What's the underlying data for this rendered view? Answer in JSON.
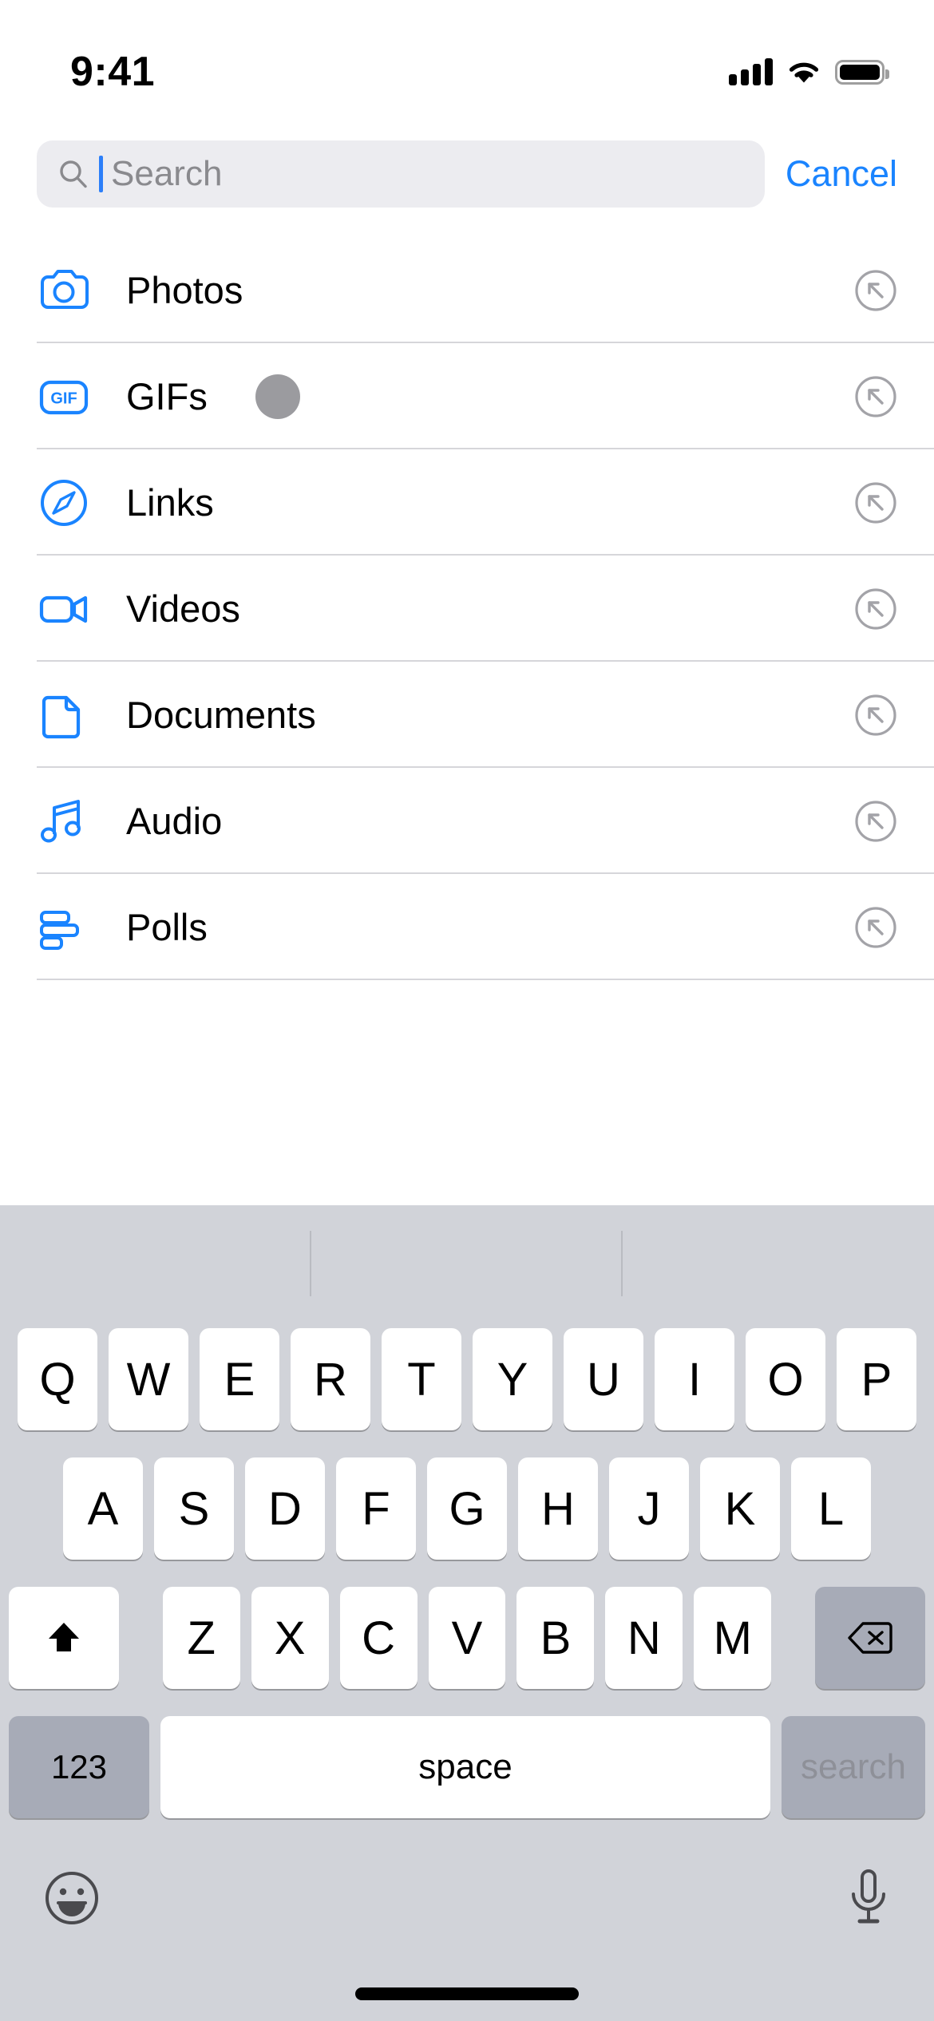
{
  "status_bar": {
    "time": "9:41",
    "cellular_icon": "cellular-signal-icon",
    "wifi_icon": "wifi-icon",
    "battery_icon": "battery-full-icon"
  },
  "search": {
    "placeholder": "Search",
    "value": "",
    "cancel_label": "Cancel",
    "search_icon": "magnifier-icon",
    "cursor_color": "#2d7ff9",
    "field_background": "#ececf0",
    "cancel_color": "#1a84ff"
  },
  "list": {
    "accent_color": "#1a84ff",
    "items": [
      {
        "label": "Photos",
        "icon": "camera-icon",
        "accessory": "arrow-up-left-circle-icon",
        "touch_indicator": false
      },
      {
        "label": "GIFs",
        "icon": "gif-badge-icon",
        "accessory": "arrow-up-left-circle-icon",
        "touch_indicator": true
      },
      {
        "label": "Links",
        "icon": "compass-icon",
        "accessory": "arrow-up-left-circle-icon",
        "touch_indicator": false
      },
      {
        "label": "Videos",
        "icon": "video-camera-icon",
        "accessory": "arrow-up-left-circle-icon",
        "touch_indicator": false
      },
      {
        "label": "Documents",
        "icon": "document-icon",
        "accessory": "arrow-up-left-circle-icon",
        "touch_indicator": false
      },
      {
        "label": "Audio",
        "icon": "music-note-icon",
        "accessory": "arrow-up-left-circle-icon",
        "touch_indicator": false
      },
      {
        "label": "Polls",
        "icon": "poll-bars-icon",
        "accessory": "arrow-up-left-circle-icon",
        "touch_indicator": false
      }
    ]
  },
  "keyboard": {
    "background": "#d1d3d9",
    "row1": [
      "Q",
      "W",
      "E",
      "R",
      "T",
      "Y",
      "U",
      "I",
      "O",
      "P"
    ],
    "row2": [
      "A",
      "S",
      "D",
      "F",
      "G",
      "H",
      "J",
      "K",
      "L"
    ],
    "row3": [
      "Z",
      "X",
      "C",
      "V",
      "B",
      "N",
      "M"
    ],
    "shift_icon": "shift-up-arrow-icon",
    "delete_icon": "delete-backward-icon",
    "numbers_label": "123",
    "space_label": "space",
    "return_label": "search",
    "emoji_icon": "emoji-smiley-icon",
    "dictation_icon": "microphone-icon"
  }
}
